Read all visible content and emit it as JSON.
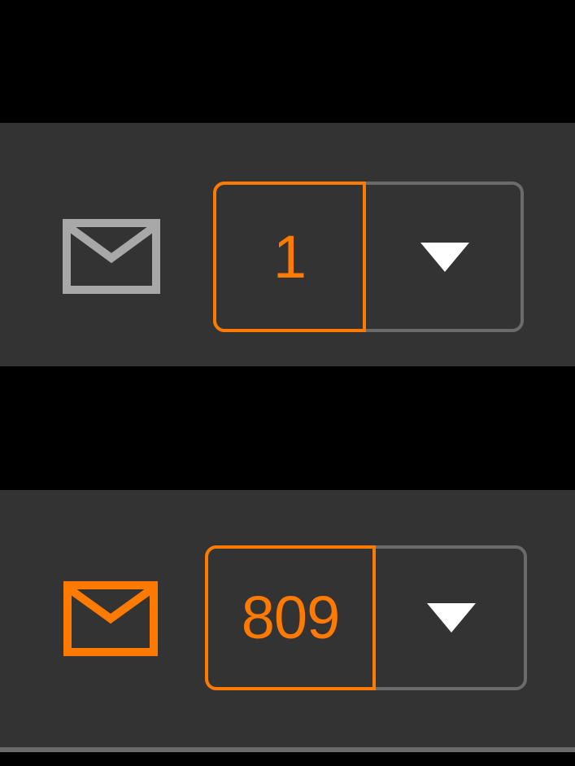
{
  "colors": {
    "background": "#000000",
    "panel": "#333333",
    "accent": "#ff7a00",
    "muted_icon": "#a8a8a8",
    "frame": "#6b6b6b",
    "caret": "#ffffff"
  },
  "panels": [
    {
      "state": "read",
      "icon": "mail-icon",
      "icon_color": "#a8a8a8",
      "count": "1",
      "dropdown_icon": "caret-down-icon"
    },
    {
      "state": "unread",
      "icon": "mail-icon",
      "icon_color": "#ff7a00",
      "count": "809",
      "dropdown_icon": "caret-down-icon"
    }
  ]
}
